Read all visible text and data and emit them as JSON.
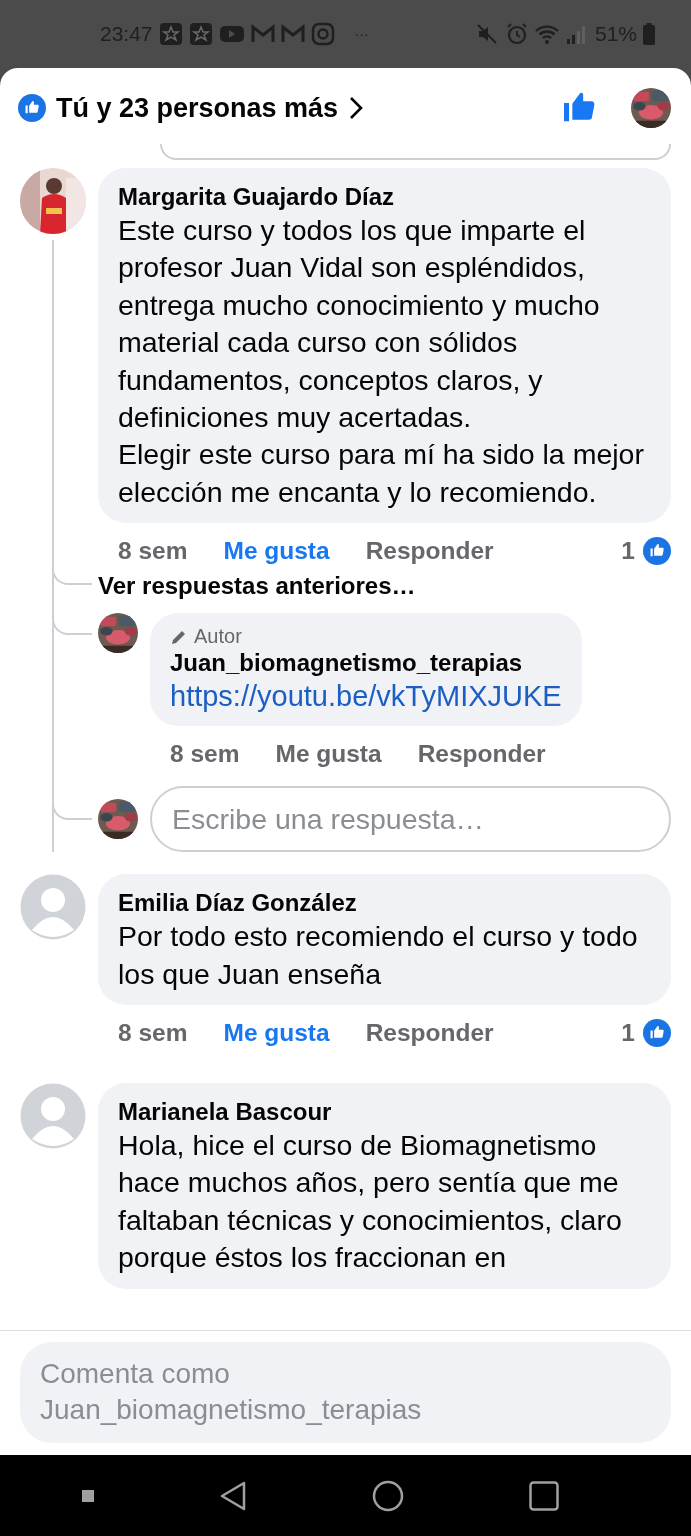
{
  "status_bar": {
    "time": "23:47",
    "notification_more": "···",
    "battery": "51%"
  },
  "header": {
    "reactions": "Tú y 23 personas más"
  },
  "comments": [
    {
      "author": "Margarita Guajardo Díaz",
      "text": "Este curso y todos los que imparte el profesor Juan Vidal son espléndidos, entrega mucho conocimiento y mucho material cada curso con sólidos fundamentos, conceptos claros, y definiciones muy acertadas.\nElegir este curso para mí ha sido la mejor elección me encanta y lo recomiendo.",
      "time": "8 sem",
      "like": "Me gusta",
      "liked": true,
      "reply": "Responder",
      "like_count": "1",
      "more_replies": "Ver respuestas anteriores…",
      "replies": [
        {
          "badge": "Autor",
          "author": "Juan_biomagnetismo_terapias",
          "link": "https://youtu.be/vkTyMIXJUKE",
          "time": "8 sem",
          "like": "Me gusta",
          "liked": false,
          "reply": "Responder"
        }
      ],
      "reply_field": {
        "placeholder": "Escribe una respuesta…"
      }
    },
    {
      "author": "Emilia Díaz González",
      "avatar": {
        "kind": "default"
      },
      "text": "Por todo esto recomiendo el curso y todo los que Juan enseña",
      "time": "8 sem",
      "like": "Me gusta",
      "liked": true,
      "reply": "Responder",
      "like_count": "1"
    },
    {
      "author": "Marianela Bascour",
      "avatar": {
        "kind": "default"
      },
      "text": "Hola, hice el curso de Biomagnetismo hace muchos años, pero sentía que me faltaban técnicas y conocimientos, claro porque éstos los fraccionan en"
    }
  ],
  "composer": {
    "placeholder": "Comenta como Juan_biomagnetismo_terapias"
  }
}
